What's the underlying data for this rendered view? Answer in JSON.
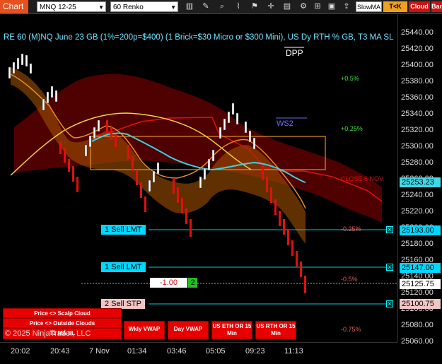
{
  "toolbar": {
    "chart_tab": "Chart",
    "instrument": "MNQ 12-25",
    "bar_type": "60 Renko",
    "slowma_label": "SlowMA",
    "tk_label": "T<K",
    "cloud_label": "Cloud",
    "bar_label": "Bar"
  },
  "chart": {
    "title": "RE 60 (M)NQ June 23 GB (1%=200p=$400) (1 Brick=$30 Micro or $300 Mini), US Dy RTH % GB, T3 MA SL",
    "dpp_label": "DPP",
    "ws2_label": "WS2",
    "close_label": "CLOSE 6 NOV",
    "copyright": "© 2025 NinjaTrader, LLC",
    "pct_levels": [
      "+0.5%",
      "+0.25%",
      "-0.25%",
      "-0.5%",
      "-0.75%"
    ],
    "colors": {
      "sell": "#00d8ff",
      "stop": "#f2c5c5",
      "cloud_red": "#7a0000",
      "orange": "#e89020",
      "cyan_line": "#40d0e0"
    }
  },
  "y_axis": {
    "labels": [
      "25440.00",
      "25420.00",
      "25400.00",
      "25380.00",
      "25360.00",
      "25340.00",
      "25320.00",
      "25300.00",
      "25280.00",
      "25260.00",
      "25240.00",
      "25220.00",
      "25200.00",
      "25180.00",
      "25160.00",
      "25140.00",
      "25120.00",
      "25100.00",
      "25080.00",
      "25060.00"
    ],
    "current_price": "25253.23",
    "sell1_price": "25193.00",
    "sell2_price": "25147.00",
    "last_price": "25125.75",
    "stop_price": "25100.75"
  },
  "x_axis": {
    "labels": [
      "20:02",
      "20:43",
      "7 Nov",
      "01:34",
      "03:46",
      "05:05",
      "09:23",
      "11:13"
    ]
  },
  "orders": {
    "sell1": "1 Sell LMT",
    "sell2": "1 Sell LMT",
    "stop": "2 Sell STP",
    "pnl": "-1.00",
    "qty": "2",
    "close_x": "✕"
  },
  "buttons": {
    "scalp_cloud": "Price <> Scalp Cloud",
    "outside_clouds": "Price <> Outside Clouds",
    "t3_ma_sl": "T3 MA SL",
    "wkly_vwap": "Wkly VWAP",
    "day_vwap": "Day VWAP",
    "us_eth_or": "US ETH OR 15 Min",
    "us_rth_or": "US RTH OR 15 Min"
  }
}
